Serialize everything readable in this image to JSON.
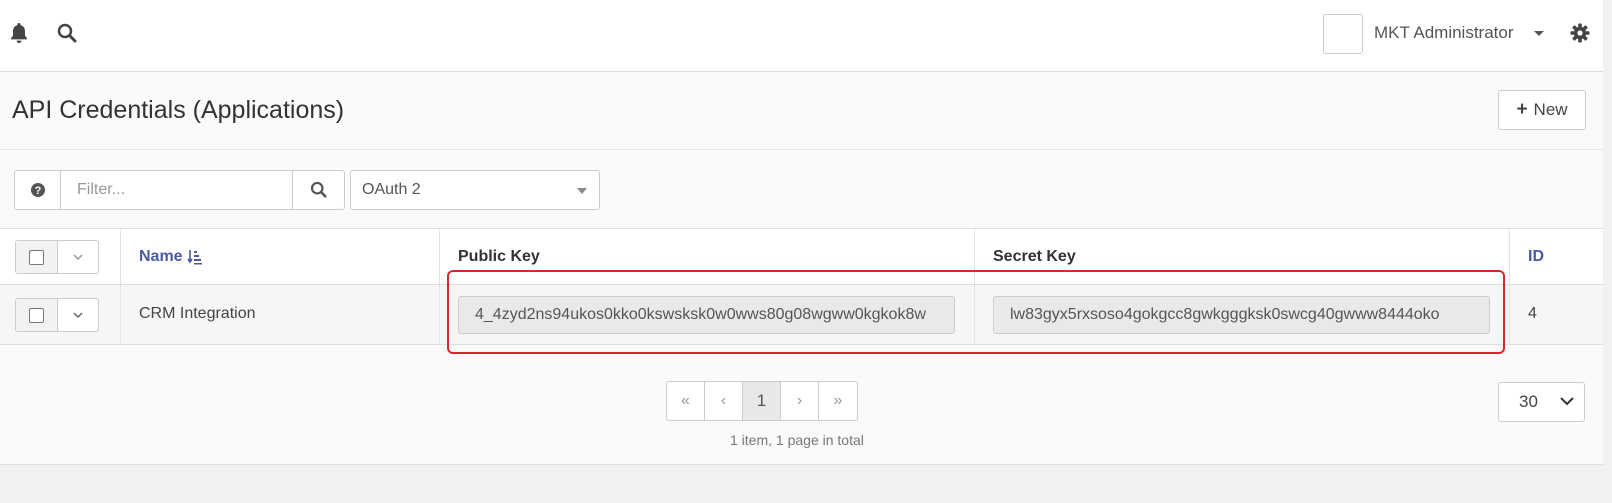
{
  "header": {
    "user_name": "MKT Administrator",
    "icons": [
      "bell-icon",
      "search-icon",
      "caret-down-icon",
      "gear-icon"
    ]
  },
  "page": {
    "title": "API Credentials (Applications)",
    "new_button_label": "New"
  },
  "filter": {
    "placeholder": "Filter...",
    "auth_type_selected": "OAuth 2"
  },
  "table": {
    "columns": [
      "Name",
      "Public Key",
      "Secret Key",
      "ID"
    ],
    "rows": [
      {
        "name": "CRM Integration",
        "public_key": "4_4zyd2ns94ukos0kko0kswsksk0w0wws80g08wgww0kgkok8w",
        "secret_key": "lw83gyx5rxsoso4gokgcc8gwkgggksk0swcg40gwww8444oko",
        "id": "4"
      }
    ]
  },
  "pagination": {
    "first": "«",
    "prev": "‹",
    "current_page": "1",
    "next": "›",
    "last": "»",
    "info": "1 item, 1 page in total",
    "per_page": "30"
  },
  "colors": {
    "highlight": "#d9252d",
    "link": "#4a5aa0"
  }
}
